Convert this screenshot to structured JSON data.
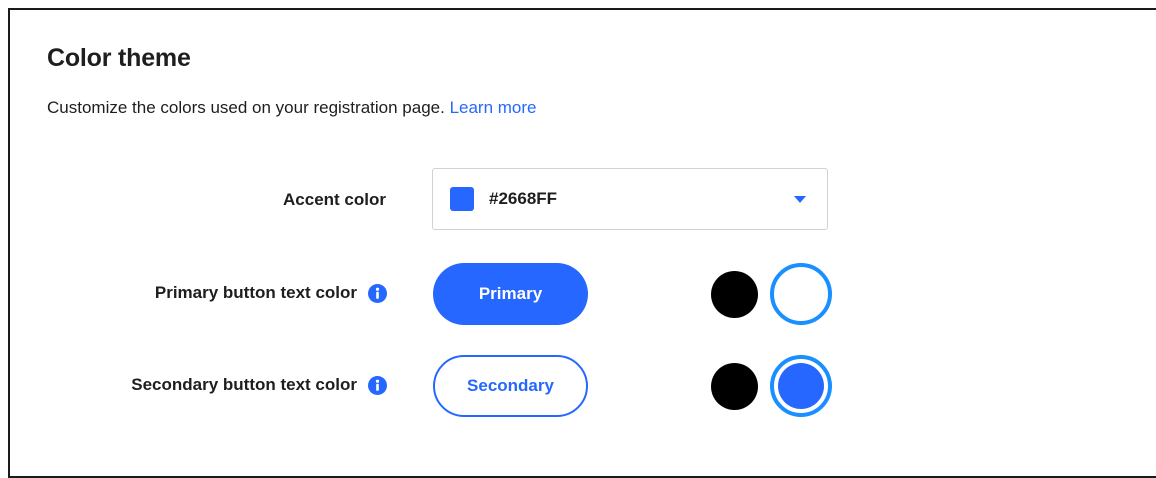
{
  "section": {
    "title": "Color theme",
    "description": "Customize the colors used on your registration page.",
    "learn_more": "Learn more"
  },
  "accent": {
    "label": "Accent color",
    "value": "#2668FF",
    "swatch_color": "#2668ff"
  },
  "primary": {
    "label": "Primary button text color",
    "preview_label": "Primary",
    "options": [
      {
        "color": "#000000",
        "selected": false
      },
      {
        "color": "#ffffff",
        "selected": true
      }
    ]
  },
  "secondary": {
    "label": "Secondary button text color",
    "preview_label": "Secondary",
    "options": [
      {
        "color": "#000000",
        "selected": false
      },
      {
        "color": "#2668ff",
        "selected": true
      }
    ]
  },
  "colors": {
    "accent": "#2668ff",
    "selection_ring": "#1a8fff",
    "text": "#1e1e1e"
  },
  "icons": {
    "info": "info-icon",
    "dropdown": "caret-down-icon"
  }
}
